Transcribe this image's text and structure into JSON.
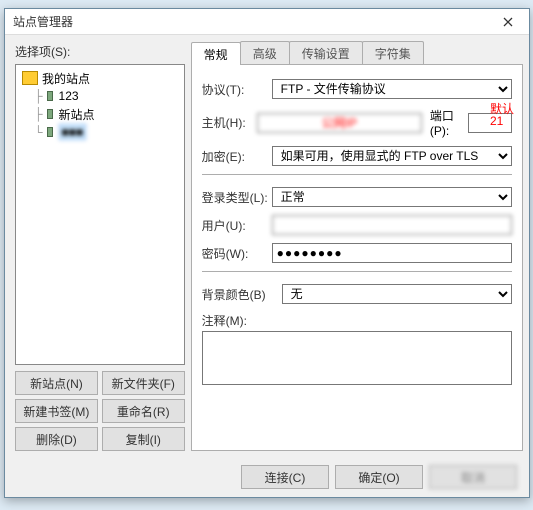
{
  "window": {
    "title": "站点管理器"
  },
  "left": {
    "select_label": "选择项(S):",
    "root": "我的站点",
    "items": [
      "123",
      "新站点",
      "■■■"
    ],
    "buttons": {
      "new_site": "新站点(N)",
      "new_folder": "新文件夹(F)",
      "new_bookmark": "新建书签(M)",
      "rename": "重命名(R)",
      "delete": "删除(D)",
      "copy": "复制(I)"
    }
  },
  "tabs": {
    "general": "常规",
    "advanced": "高级",
    "transfer": "传输设置",
    "charset": "字符集"
  },
  "form": {
    "protocol_label": "协议(T):",
    "protocol_value": "FTP - 文件传输协议",
    "host_label": "主机(H):",
    "host_value": "公网IP",
    "port_label": "端口(P):",
    "port_value": "",
    "port_annotation": "默认\n21",
    "encryption_label": "加密(E):",
    "encryption_value": "如果可用，使用显式的 FTP over TLS",
    "login_type_label": "登录类型(L):",
    "login_type_value": "正常",
    "user_label": "用户(U):",
    "user_value": "",
    "password_label": "密码(W):",
    "password_value": "●●●●●●●●",
    "bgcolor_label": "背景颜色(B)",
    "bgcolor_value": "无",
    "comments_label": "注释(M):",
    "comments_value": ""
  },
  "footer": {
    "connect": "连接(C)",
    "ok": "确定(O)",
    "cancel": "取消"
  }
}
